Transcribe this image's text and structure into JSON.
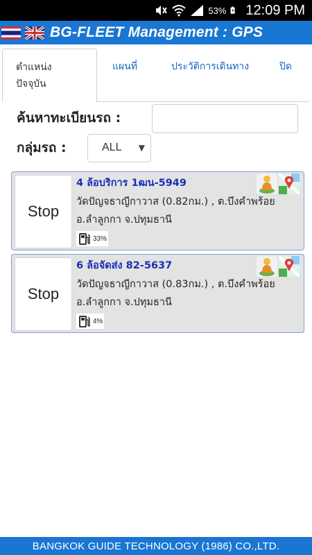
{
  "status_bar": {
    "battery_percent": "53%",
    "time": "12:09 PM",
    "icons": [
      "mute-icon",
      "wifi-icon",
      "signal-icon",
      "battery-icon"
    ]
  },
  "header": {
    "title": "BG-FLEET Management : GPS",
    "flags": [
      "thailand-flag-icon",
      "uk-flag-icon"
    ],
    "color": "#1976d2"
  },
  "tabs": [
    {
      "label": "ตำแหน่งปัจจุบัน",
      "active": true
    },
    {
      "label": "แผนที่",
      "active": false
    },
    {
      "label": "ประวัติการเดินทาง",
      "active": false
    },
    {
      "label": "ปิด",
      "active": false
    }
  ],
  "search": {
    "plate_label": "ค้นหาทะเบียนรถ :",
    "plate_value": "",
    "group_label": "กลุ่มรถ :",
    "group_selected": "ALL"
  },
  "vehicles": [
    {
      "button": "Stop",
      "name": "4 ล้อบริการ 1ฒน-5949",
      "address": "วัดปัญจธาญีกาวาส (0.82กม.) , ต.บึงคำพร้อย อ.ลำลูกกา จ.ปทุมธานี",
      "fuel_percent": "33%"
    },
    {
      "button": "Stop",
      "name": "6 ล้อจัดส่ง 82-5637",
      "address": "วัดปัญจธาญีกาวาส (0.83กม.) , ต.บึงคำพร้อย อ.ลำลูกกา จ.ปทุมธานี",
      "fuel_percent": "4%"
    }
  ],
  "footer": {
    "text": "BANGKOK GUIDE TECHNOLOGY (1986) CO.,LTD."
  }
}
